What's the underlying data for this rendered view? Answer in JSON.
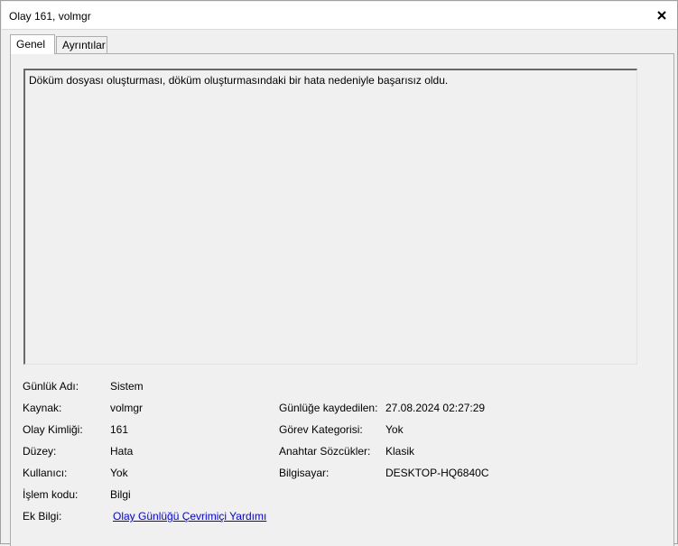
{
  "window": {
    "title": "Olay 161, volmgr"
  },
  "tabs": [
    {
      "label": "Genel"
    },
    {
      "label": "Ayrıntılar"
    }
  ],
  "description": "Döküm dosyası oluşturması, döküm oluşturmasındaki bir hata nedeniyle başarısız oldu.",
  "fields": {
    "log_name_label": "Günlük Adı:",
    "log_name_value": "Sistem",
    "source_label": "Kaynak:",
    "source_value": "volmgr",
    "logged_label": "Günlüğe kaydedilen:",
    "logged_value": "27.08.2024 02:27:29",
    "event_id_label": "Olay Kimliği:",
    "event_id_value": "161",
    "task_category_label": "Görev Kategorisi:",
    "task_category_value": "Yok",
    "level_label": "Düzey:",
    "level_value": "Hata",
    "keywords_label": "Anahtar Sözcükler:",
    "keywords_value": "Klasik",
    "user_label": "Kullanıcı:",
    "user_value": "Yok",
    "computer_label": "Bilgisayar:",
    "computer_value": "DESKTOP-HQ6840C",
    "opcode_label": "İşlem kodu:",
    "opcode_value": "Bilgi",
    "more_info_label": "Ek Bilgi:",
    "more_info_link": "Olay Günlüğü Çevrimiçi Yardımı"
  }
}
